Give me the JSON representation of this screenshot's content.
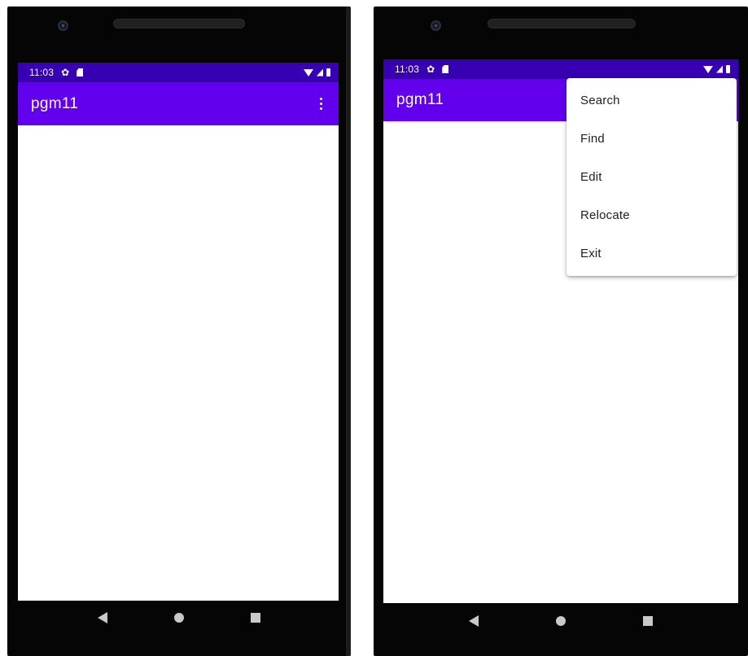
{
  "left_phone": {
    "status_bar": {
      "time": "11:03",
      "icons_left": [
        "gear-icon",
        "sd-card-icon"
      ],
      "icons_right": [
        "wifi-icon",
        "cell-signal-icon",
        "battery-icon"
      ]
    },
    "app_bar": {
      "title": "pgm11",
      "overflow_icon": "more-vert-icon"
    },
    "nav_bar": {
      "icons": [
        "back-icon",
        "home-icon",
        "recents-icon"
      ]
    }
  },
  "right_phone": {
    "status_bar": {
      "time": "11:03",
      "icons_left": [
        "gear-icon",
        "sd-card-icon"
      ],
      "icons_right": [
        "wifi-icon",
        "cell-signal-icon",
        "battery-icon"
      ]
    },
    "app_bar": {
      "title": "pgm11"
    },
    "overflow_menu": {
      "items": [
        {
          "label": "Search"
        },
        {
          "label": "Find"
        },
        {
          "label": "Edit"
        },
        {
          "label": "Relocate"
        },
        {
          "label": "Exit"
        }
      ]
    },
    "nav_bar": {
      "icons": [
        "back-icon",
        "home-icon",
        "recents-icon"
      ]
    }
  },
  "colors": {
    "status_bar": "#3700b3",
    "app_bar": "#6200ee",
    "device_frame": "#050505",
    "nav_icon": "#c9c9c9",
    "menu_text": "#212121"
  }
}
